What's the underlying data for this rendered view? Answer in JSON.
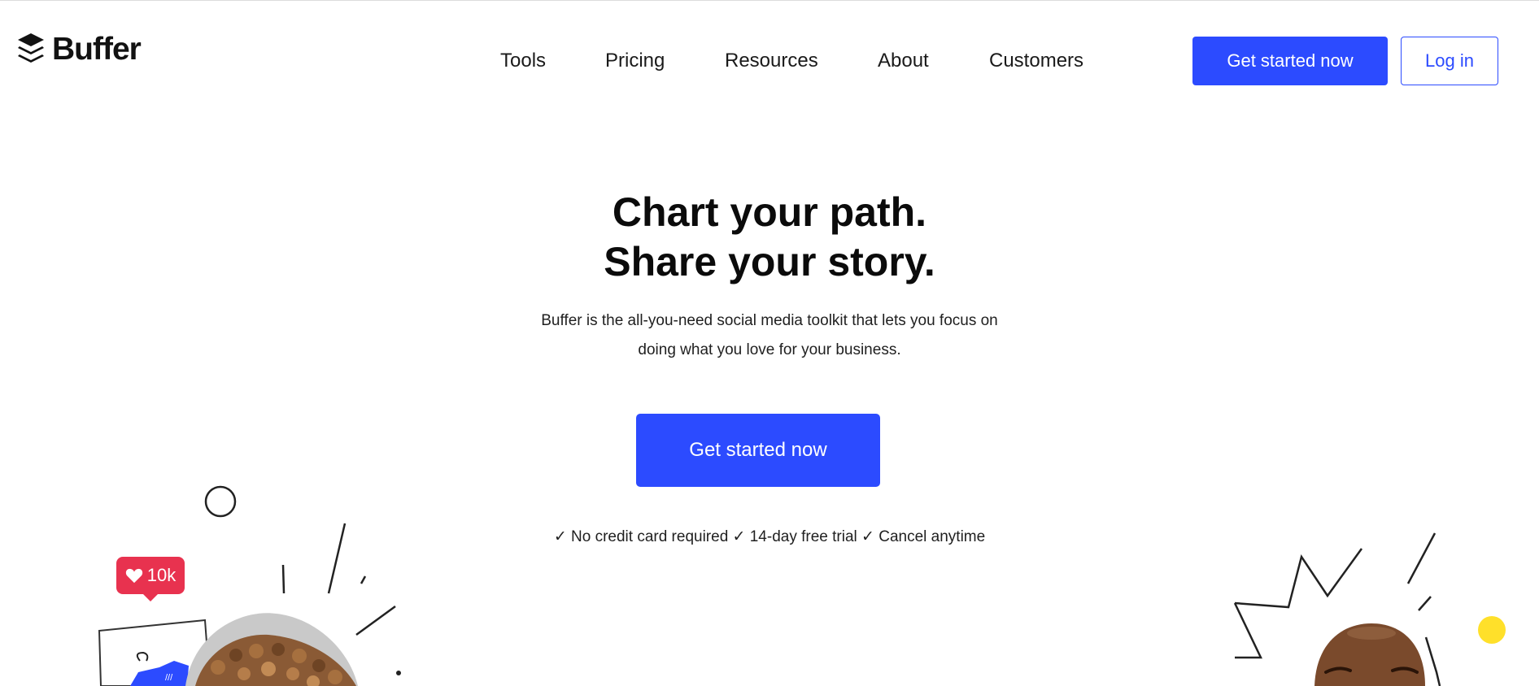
{
  "brand": {
    "name": "Buffer",
    "logo_icon": "buffer-layers-icon"
  },
  "nav": {
    "items": [
      {
        "label": "Tools"
      },
      {
        "label": "Pricing"
      },
      {
        "label": "Resources"
      },
      {
        "label": "About"
      },
      {
        "label": "Customers"
      }
    ],
    "cta_label": "Get started now",
    "login_label": "Log in"
  },
  "hero": {
    "title_line1": "Chart your path.",
    "title_line2": "Share your story.",
    "subtitle": "Buffer is the all-you-need social media toolkit that lets you focus on doing what you love for your business.",
    "cta_label": "Get started now",
    "perks": "✓ No credit card required ✓ 14-day free trial ✓ Cancel anytime"
  },
  "like_badge": {
    "count": "10k",
    "icon": "heart-icon"
  },
  "colors": {
    "accent": "#2c4bff",
    "badge": "#e8324f",
    "yellow": "#ffe02a",
    "text": "#121212"
  }
}
